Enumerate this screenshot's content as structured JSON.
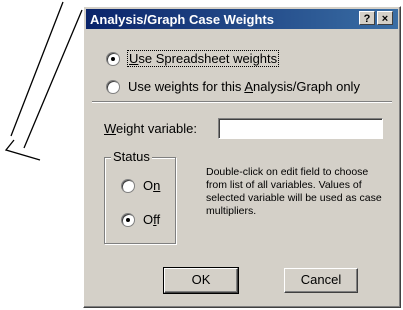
{
  "dialog": {
    "title": "Analysis/Graph Case Weights",
    "help_button": "?",
    "close_button": "×"
  },
  "weights_source": {
    "options": [
      {
        "pre": "",
        "key": "U",
        "post": "se Spreadsheet weights",
        "checked": true
      },
      {
        "pre": "Use weights for this ",
        "key": "A",
        "post": "nalysis/Graph only",
        "checked": false
      }
    ]
  },
  "weight_variable": {
    "label_key": "W",
    "label_rest": "eight variable:",
    "value": ""
  },
  "status": {
    "legend": "Status",
    "on": {
      "pre": "O",
      "key": "n",
      "checked": false
    },
    "off": {
      "pre": "O",
      "key": "f",
      "post": "f",
      "checked": true
    }
  },
  "note": "Double-click on edit field to choose from list of all variables. Values of selected variable will be used as case multipliers.",
  "buttons": {
    "ok": "OK",
    "cancel": "Cancel"
  }
}
